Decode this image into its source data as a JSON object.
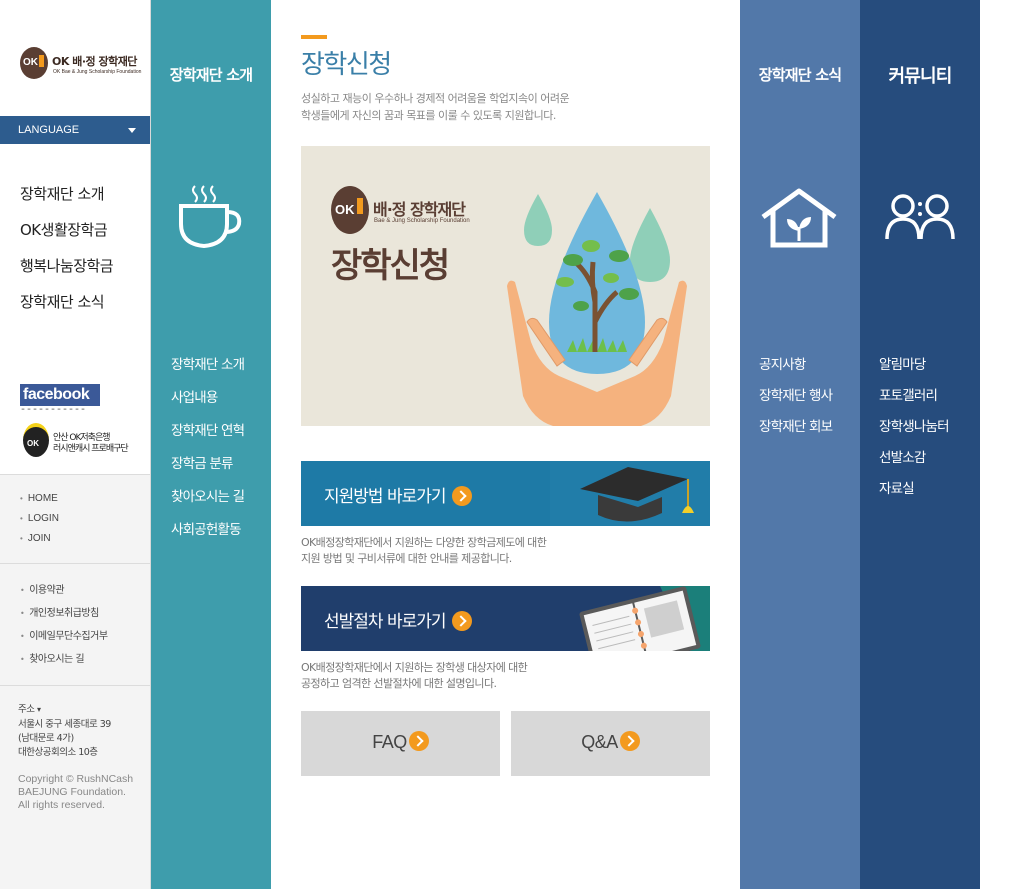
{
  "logo": {
    "mark": "OK",
    "name": "OK 배·정 장학재단",
    "sub": "OK Bae & Jung Scholarship Foundation"
  },
  "language": {
    "label": "LANGUAGE"
  },
  "gnb": [
    "장학재단 소개",
    "OK생활장학금",
    "행복나눔장학금",
    "장학재단 소식"
  ],
  "social": {
    "facebook": "facebook",
    "dash": "-----------"
  },
  "okbank": {
    "mark": "OK",
    "line1": "안산 OK저축은행",
    "line2": "러시앤캐시 프로배구단"
  },
  "util_links": [
    "HOME",
    "LOGIN",
    "JOIN"
  ],
  "policy_links": [
    "이용약관",
    "개인정보취급방침",
    "이메일무단수집거부",
    "찾아오시는 길"
  ],
  "footer": {
    "address_label": "주소",
    "address_lines": [
      "서울시 중구 세종대로 39",
      "(남대문로 4가)",
      "대한상공회의소 10층"
    ],
    "copyright_lines": [
      "Copyright  © RushNCash",
      "BAEJUNG Foundation.",
      "All rights reserved."
    ]
  },
  "col_intro": {
    "title": "장학재단 소개",
    "items": [
      "장학재단 소개",
      "사업내용",
      "장학재단 연혁",
      "장학금 분류",
      "찾아오시는 길",
      "사회공헌활동"
    ]
  },
  "main": {
    "title": "장학신청",
    "desc_lines": [
      "성실하고 재능이 우수하나 경제적 어려움을 학업지속이 어려운",
      "학생들에게 자신의 꿈과 목표를 이룰 수 있도록 지원합니다."
    ],
    "hero": {
      "mark": "OK",
      "name": "배·정 장학재단",
      "sub": "Bae & Jung Scholarship Foundation",
      "title": "장학신청"
    },
    "banner1": {
      "label": "지원방법 바로가기",
      "desc_lines": [
        "OK배정장학재단에서 지원하는 다양한 장학금제도에 대한",
        "지원 방법 및 구비서류에 대한 안내를 제공합니다."
      ]
    },
    "banner2": {
      "label": "선발절차 바로가기",
      "desc_lines": [
        "OK배정장학재단에서 지원하는 장학생 대상자에 대한",
        "공정하고 엄격한 선발절차에 대한 설명입니다."
      ]
    },
    "faq": "FAQ",
    "qa": "Q&A"
  },
  "col_news": {
    "title": "장학재단 소식",
    "items": [
      "공지사항",
      "장학재단 행사",
      "장학재단 회보"
    ]
  },
  "col_comm": {
    "title": "커뮤니티",
    "items": [
      "알림마당",
      "포토갤러리",
      "장학생나눔터",
      "선발소감",
      "자료실"
    ]
  },
  "colors": {
    "teal": "#3e9dac",
    "news_blue": "#5278a9",
    "comm_navy": "#264c7d",
    "accent_orange": "#f39a1e",
    "title_blue": "#3a7fa8",
    "lang_blue": "#2d5c8e"
  },
  "icons": {
    "intro": "coffee-cup-icon",
    "news": "house-sprout-icon",
    "comm": "people-icon",
    "arrow": "arrow-circle-icon"
  }
}
